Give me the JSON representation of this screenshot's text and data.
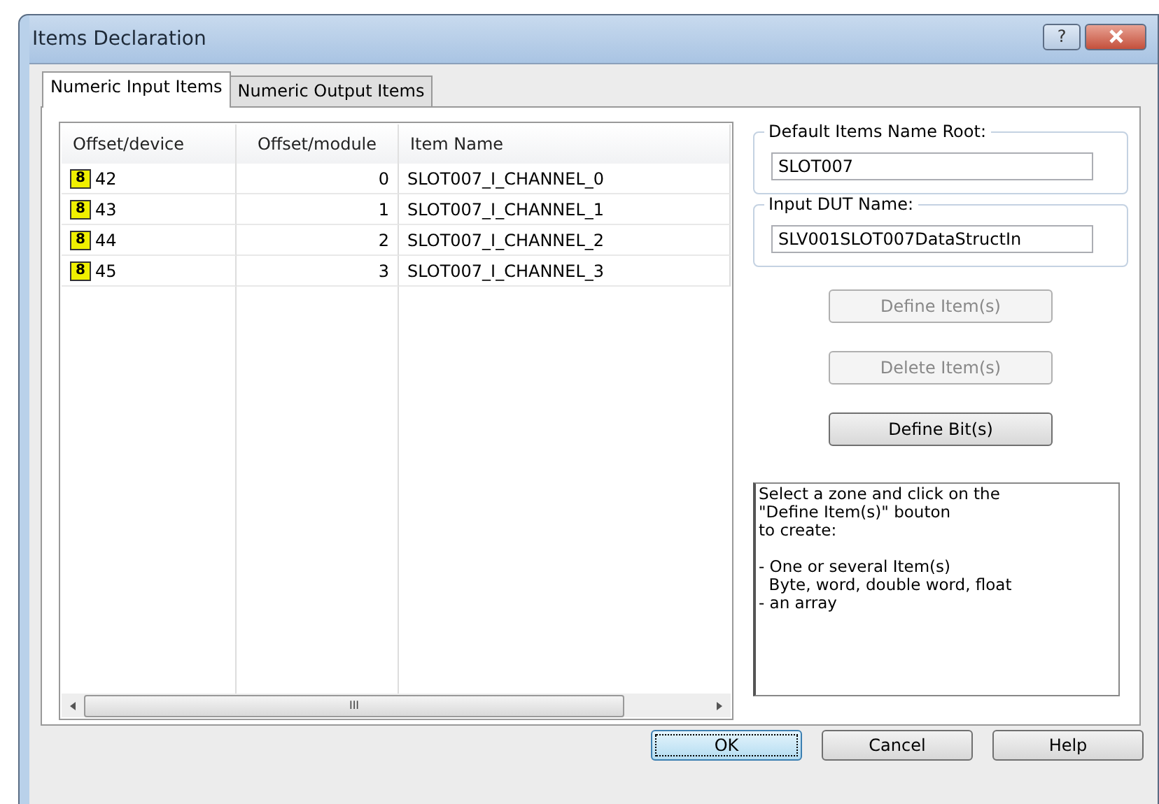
{
  "window": {
    "title": "Items Declaration",
    "buttons": [
      {
        "kind": "help",
        "label": "?"
      },
      {
        "kind": "close"
      }
    ]
  },
  "tabs": [
    {
      "label": "Numeric Input Items",
      "selected": true
    },
    {
      "label": "Numeric Output Items",
      "selected": false
    }
  ],
  "table": {
    "columns": [
      "Offset/device",
      "Offset/module",
      "Item Name"
    ],
    "rows": [
      {
        "badge": "8",
        "device": "42",
        "module": "0",
        "name": "SLOT007_I_CHANNEL_0"
      },
      {
        "badge": "8",
        "device": "43",
        "module": "1",
        "name": "SLOT007_I_CHANNEL_1"
      },
      {
        "badge": "8",
        "device": "44",
        "module": "2",
        "name": "SLOT007_I_CHANNEL_2"
      },
      {
        "badge": "8",
        "device": "45",
        "module": "3",
        "name": "SLOT007_I_CHANNEL_3"
      }
    ],
    "scrollbar_grip": "III"
  },
  "groups": [
    {
      "label": "Default Items Name Root:",
      "value": "SLOT007"
    },
    {
      "label": "Input DUT Name:",
      "value": "SLV001SLOT007DataStructIn"
    }
  ],
  "actions": [
    {
      "label": "Define Item(s)",
      "disabled": true
    },
    {
      "label": "Delete Item(s)",
      "disabled": true
    },
    {
      "label": "Define Bit(s)",
      "disabled": false
    }
  ],
  "help_text": "Select a zone and click on the\n\"Define Item(s)\" bouton\nto create:\n\n- One or several Item(s)\n  Byte, word, double word, float\n- an array",
  "footer_buttons": [
    {
      "label": "OK",
      "default": true
    },
    {
      "label": "Cancel",
      "default": false
    },
    {
      "label": "Help",
      "default": false
    }
  ]
}
